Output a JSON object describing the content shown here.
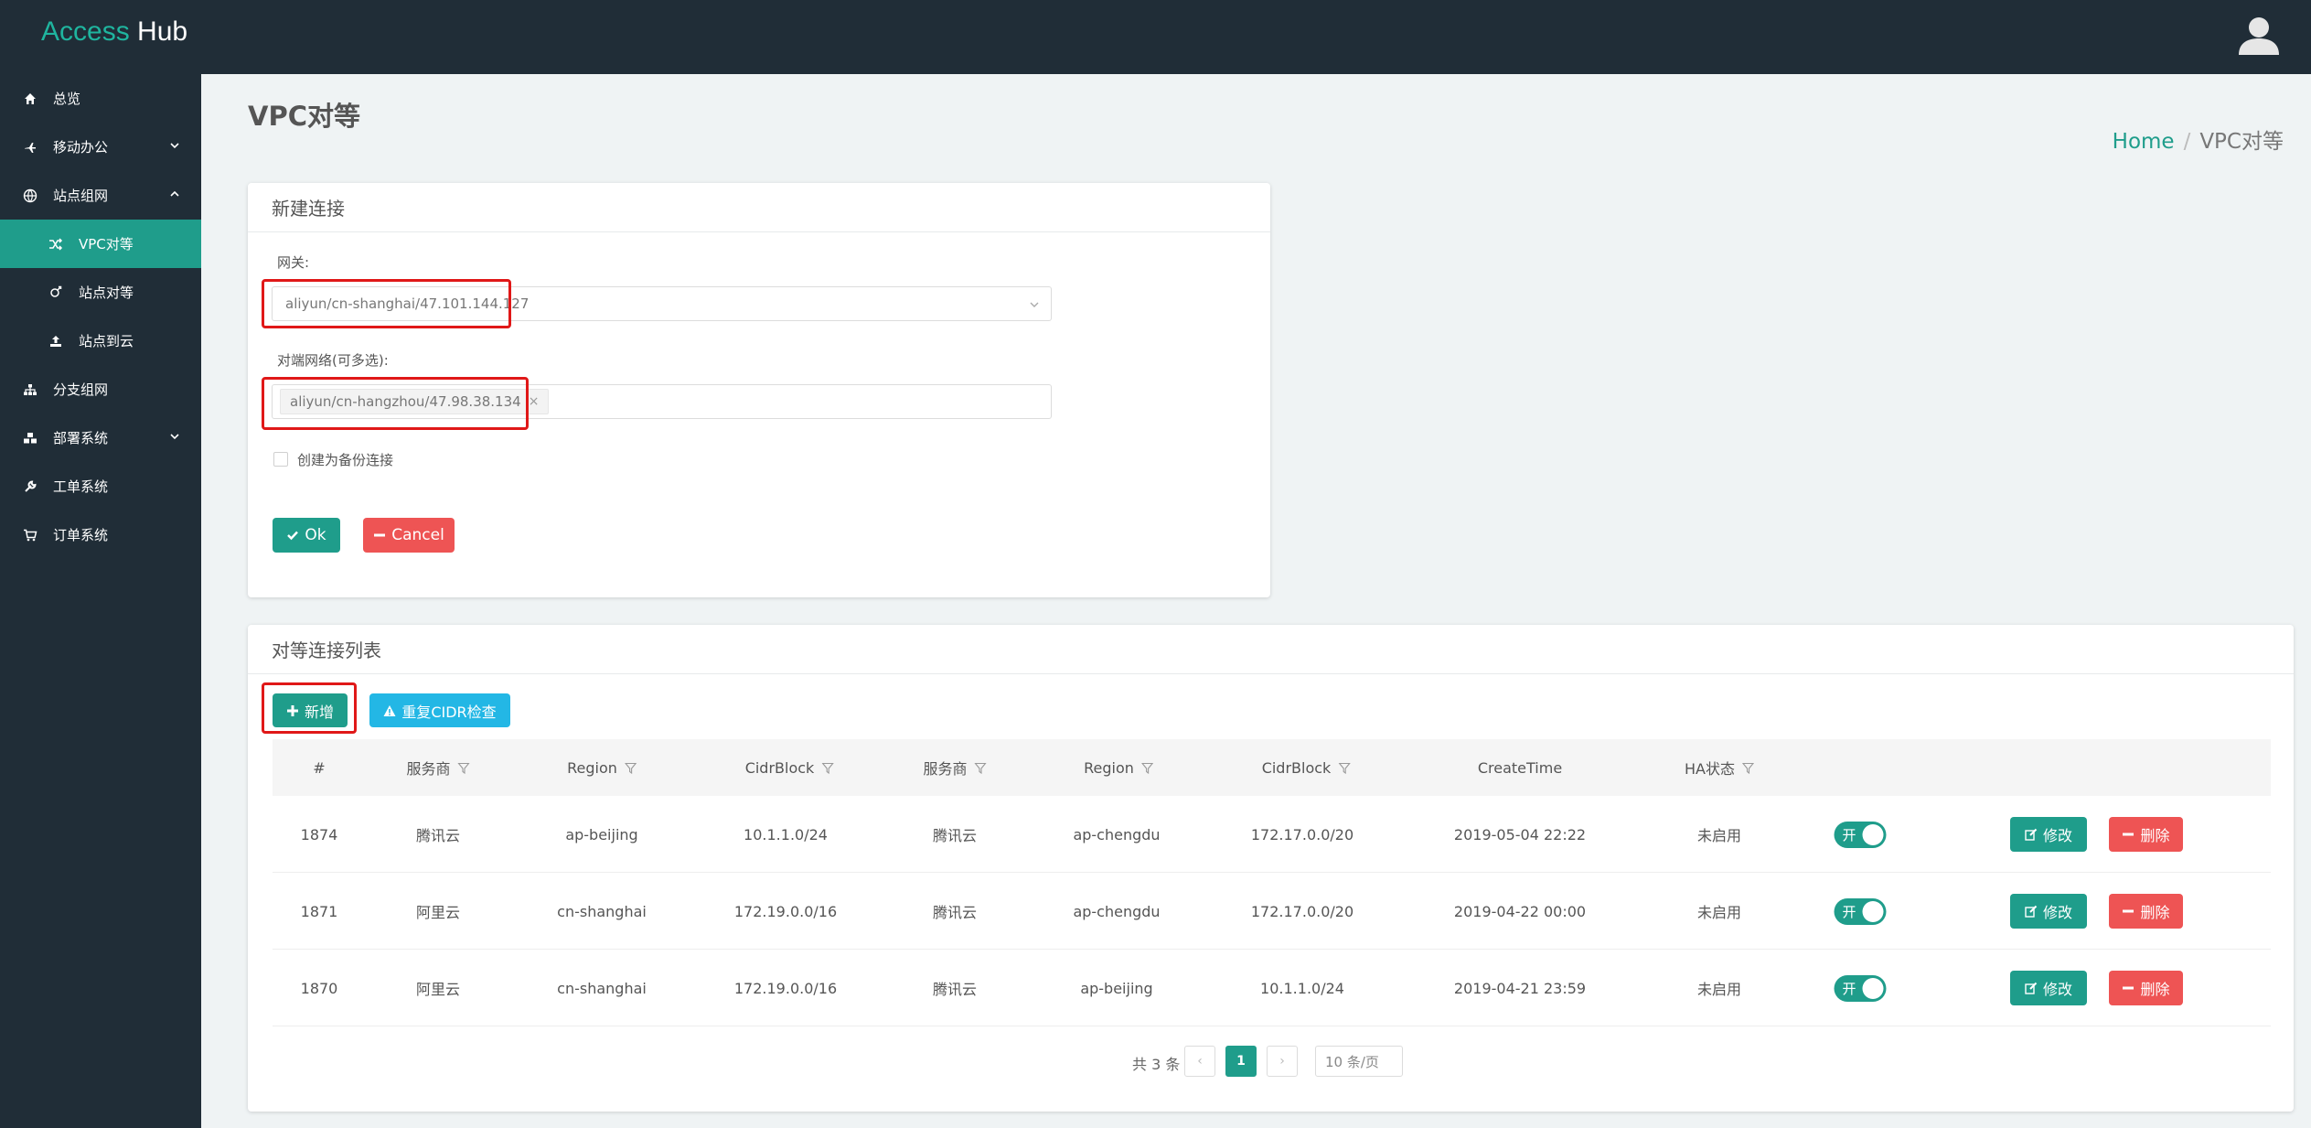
{
  "app": {
    "brand_part1": "Access",
    "brand_part2": "Hub"
  },
  "sidebar": {
    "items": [
      {
        "label": "总览",
        "icon": "home-icon"
      },
      {
        "label": "移动办公",
        "icon": "plane-icon"
      },
      {
        "label": "站点组网",
        "icon": "network-icon"
      },
      {
        "label": "VPC对等",
        "icon": "shuffle-icon"
      },
      {
        "label": "站点对等",
        "icon": "venus-icon"
      },
      {
        "label": "站点到云",
        "icon": "upload-icon"
      },
      {
        "label": "分支组网",
        "icon": "sitemap-icon"
      },
      {
        "label": "部署系统",
        "icon": "cubes-icon"
      },
      {
        "label": "工单系统",
        "icon": "wrench-icon"
      },
      {
        "label": "订单系统",
        "icon": "cart-icon"
      }
    ]
  },
  "page": {
    "title": "VPC对等",
    "breadcrumb": {
      "home": "Home",
      "current": "VPC对等"
    }
  },
  "new_connection": {
    "title": "新建连接",
    "gateway_label": "网关:",
    "gateway_value": "aliyun/cn-shanghai/47.101.144.127",
    "peer_label": "对端网络(可多选):",
    "peer_tag": "aliyun/cn-hangzhou/47.98.38.134",
    "peer_tag_remove": "×",
    "backup_label": "创建为备份连接",
    "ok_label": "Ok",
    "cancel_label": "Cancel"
  },
  "list": {
    "title": "对等连接列表",
    "add_label": "新增",
    "check_label": "重复CIDR检查",
    "columns": [
      "#",
      "服务商",
      "Region",
      "CidrBlock",
      "服务商",
      "Region",
      "CidrBlock",
      "CreateTime",
      "HA状态"
    ],
    "rows": [
      {
        "id": "1874",
        "provider1": "腾讯云",
        "region1": "ap-beijing",
        "cidr1": "10.1.1.0/24",
        "provider2": "腾讯云",
        "region2": "ap-chengdu",
        "cidr2": "172.17.0.0/20",
        "created": "2019-05-04 22:22",
        "ha": "未启用",
        "switch": "开",
        "edit": "修改",
        "delete": "删除"
      },
      {
        "id": "1871",
        "provider1": "阿里云",
        "region1": "cn-shanghai",
        "cidr1": "172.19.0.0/16",
        "provider2": "腾讯云",
        "region2": "ap-chengdu",
        "cidr2": "172.17.0.0/20",
        "created": "2019-04-22 00:00",
        "ha": "未启用",
        "switch": "开",
        "edit": "修改",
        "delete": "删除"
      },
      {
        "id": "1870",
        "provider1": "阿里云",
        "region1": "cn-shanghai",
        "cidr1": "172.19.0.0/16",
        "provider2": "腾讯云",
        "region2": "ap-beijing",
        "cidr2": "10.1.1.0/24",
        "created": "2019-04-21 23:59",
        "ha": "未启用",
        "switch": "开",
        "edit": "修改",
        "delete": "删除"
      }
    ],
    "pagination": {
      "total": "共 3 条",
      "current_page": "1",
      "prev": "‹",
      "next": "›",
      "page_size": "10 条/页"
    }
  },
  "colors": {
    "accent": "#1f9d8b",
    "danger": "#ee5454",
    "info": "#23b7e5",
    "sidebar_bg": "#202d37",
    "highlight": "#e01818"
  }
}
